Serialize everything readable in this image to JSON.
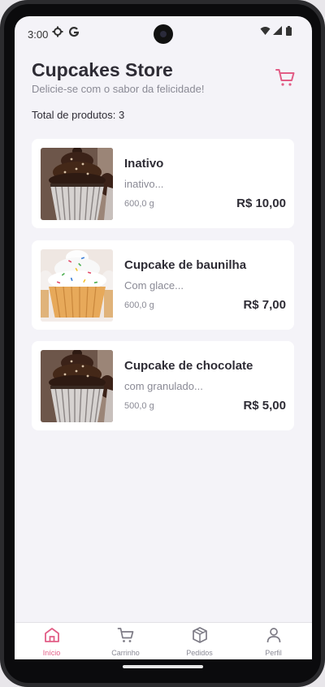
{
  "status": {
    "time": "3:00"
  },
  "header": {
    "title": "Cupcakes Store",
    "subtitle": "Delicie-se com o sabor da felicidade!",
    "accent": "#e25d86"
  },
  "summary": {
    "total_label": "Total de produtos: 3"
  },
  "products": [
    {
      "name": "Inativo",
      "description": "inativo...",
      "weight": "600,0 g",
      "price": "R$ 10,00",
      "image": "chocolate-cupcake"
    },
    {
      "name": "Cupcake de baunilha",
      "description": "Com glace...",
      "weight": "600,0 g",
      "price": "R$ 7,00",
      "image": "vanilla-cupcake"
    },
    {
      "name": "Cupcake de chocolate",
      "description": "com granulado...",
      "weight": "500,0 g",
      "price": "R$ 5,00",
      "image": "chocolate-cupcake"
    }
  ],
  "nav": {
    "items": [
      {
        "label": "Início",
        "icon": "home-icon",
        "active": true
      },
      {
        "label": "Carrinho",
        "icon": "cart-icon",
        "active": false
      },
      {
        "label": "Pedidos",
        "icon": "box-icon",
        "active": false
      },
      {
        "label": "Perfil",
        "icon": "user-icon",
        "active": false
      }
    ]
  }
}
